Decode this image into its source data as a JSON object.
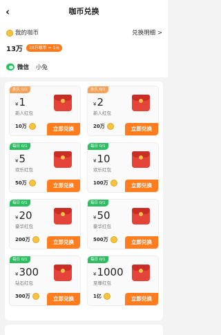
{
  "header": {
    "title": "咖币兑换"
  },
  "account": {
    "my_coin_label": "我的咖币",
    "detail_link": "兑换明细 >",
    "coin_amount": "13万",
    "rate_badge": "10万咖币 = 1元",
    "wechat_label": "微信",
    "user_name": "小兔"
  },
  "cards": [
    {
      "tag": "永久 0/1",
      "tag_type": "permanent",
      "yen": "¥",
      "amount": "1",
      "name": "新人红包",
      "cost": "10万",
      "button": "立即兑换"
    },
    {
      "tag": "永久 0/1",
      "tag_type": "permanent",
      "yen": "¥",
      "amount": "2",
      "name": "新人红包",
      "cost": "20万",
      "button": "立即兑换"
    },
    {
      "tag": "每日 0/1",
      "tag_type": "daily",
      "yen": "¥",
      "amount": "5",
      "name": "欢乐红包",
      "cost": "50万",
      "button": "立即兑换"
    },
    {
      "tag": "每日 0/1",
      "tag_type": "daily",
      "yen": "¥",
      "amount": "10",
      "name": "欢乐红包",
      "cost": "100万",
      "button": "立即兑换"
    },
    {
      "tag": "每日 0/1",
      "tag_type": "daily",
      "yen": "¥",
      "amount": "20",
      "name": "豪华红包",
      "cost": "200万",
      "button": "立即兑换"
    },
    {
      "tag": "每日 0/1",
      "tag_type": "daily",
      "yen": "¥",
      "amount": "50",
      "name": "豪华红包",
      "cost": "500万",
      "button": "立即兑换"
    },
    {
      "tag": "每日 0/1",
      "tag_type": "daily",
      "yen": "¥",
      "amount": "300",
      "name": "钻石红包",
      "cost": "300万",
      "button": "立即兑换"
    },
    {
      "tag": "每日 0/1",
      "tag_type": "daily",
      "yen": "¥",
      "amount": "1000",
      "name": "至尊红包",
      "cost": "1亿",
      "button": "立即兑换"
    }
  ],
  "colors": {
    "accent": "#ff7d1f",
    "daily_tag": "#2ebd63",
    "permanent_tag": "#f6a25a",
    "wechat": "#22c35e"
  }
}
